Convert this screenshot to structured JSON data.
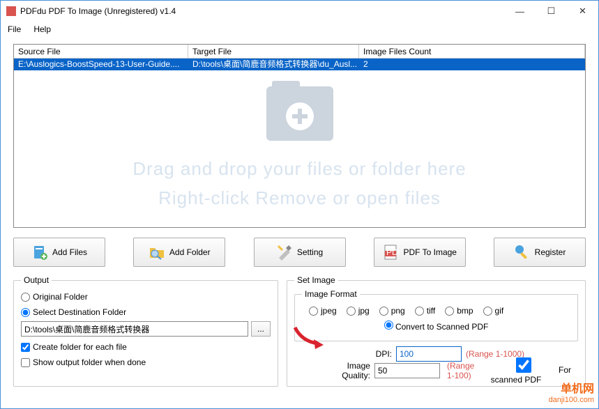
{
  "window": {
    "title": "PDFdu PDF To Image (Unregistered) v1.4"
  },
  "menu": {
    "file": "File",
    "help": "Help"
  },
  "table": {
    "headers": {
      "source": "Source File",
      "target": "Target File",
      "count": "Image Files Count"
    },
    "rows": [
      {
        "source": "E:\\Auslogics-BoostSpeed-13-User-Guide....",
        "target": "D:\\tools\\桌面\\简鹿音频格式转换器\\du_Ausl...",
        "count": "2"
      }
    ]
  },
  "dropzone": {
    "line1": "Drag and drop your files or folder here",
    "line2": "Right-click Remove or open files"
  },
  "buttons": {
    "addFiles": "Add Files",
    "addFolder": "Add Folder",
    "setting": "Setting",
    "pdfToImage": "PDF To Image",
    "register": "Register"
  },
  "output": {
    "legend": "Output",
    "original": "Original Folder",
    "selectDest": "Select Destination Folder",
    "destPath": "D:\\tools\\桌面\\简鹿音频格式转换器",
    "browse": "...",
    "createFolder": "Create folder for each file",
    "showFolder": "Show output folder when done"
  },
  "setImage": {
    "legend": "Set Image",
    "formatLegend": "Image Format",
    "formats": {
      "jpeg": "jpeg",
      "jpg": "jpg",
      "png": "png",
      "tiff": "tiff",
      "bmp": "bmp",
      "gif": "gif"
    },
    "convertScanned": "Convert to Scanned PDF",
    "dpiLabel": "DPI:",
    "dpiValue": "100",
    "dpiRange": "(Range 1-1000)",
    "qualityLabel": "Image Quality:",
    "qualityValue": "50",
    "qualityRange": "(Range 1-100)",
    "forScanned": "For scanned PDF"
  },
  "watermark": {
    "top": "单机网",
    "bottom": "danji100.com"
  }
}
